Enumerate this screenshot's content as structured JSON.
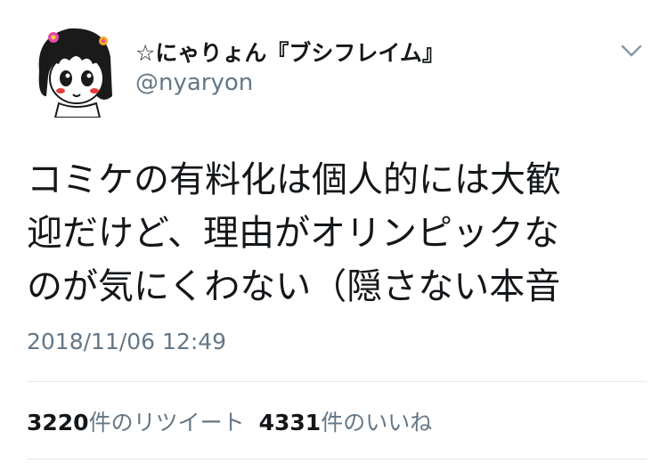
{
  "author": {
    "display_name": "☆にゃりょん『ブシフレイム』",
    "handle": "@nyaryon",
    "avatar_icon": "anime-girl-avatar-icon"
  },
  "tweet": {
    "lines": [
      "コミケの有料化は個人的には大歓",
      "迎だけど、理由がオリンピックな",
      "のが気にくわない（隠さない本音"
    ],
    "timestamp": "2018/11/06 12:49"
  },
  "stats": {
    "retweets_count": "3220",
    "retweets_label": "件のリツイート",
    "likes_count": "4331",
    "likes_label": "件のいいね"
  },
  "menu_icon": "chevron-down-icon",
  "colors": {
    "text": "#14171a",
    "secondary": "#657786",
    "divider": "#e1e8ed"
  }
}
